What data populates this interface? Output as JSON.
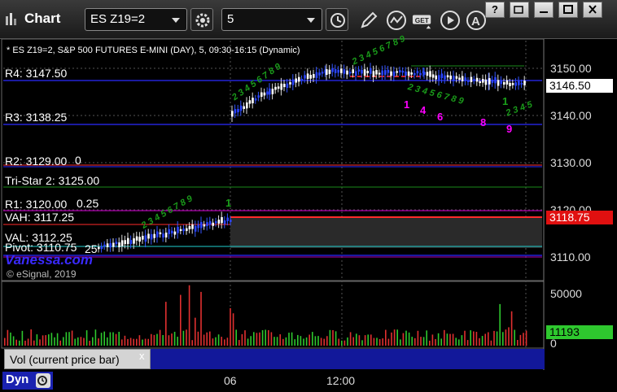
{
  "window": {
    "title": "Chart",
    "help_label": "?"
  },
  "toolbar": {
    "symbol_value": "ES Z19=2",
    "interval_value": "5",
    "icons": [
      "settings-icon",
      "clock-icon",
      "pencil-icon",
      "studies-icon",
      "get-icon",
      "play-icon",
      "link-icon"
    ]
  },
  "chart": {
    "header": "* ES Z19=2, S&P 500 FUTURES E-MINI (DAY), 5, 09:30-16:15 (Dynamic)",
    "watermark": "© eSignal, 2019",
    "brand": "Vanessa.com",
    "price_axis": {
      "ticks": [
        "3150.00",
        "3140.00",
        "3130.00",
        "3120.00",
        "3110.00"
      ],
      "current_price": "3146.50",
      "vah_price": "3118.75"
    },
    "levels": [
      {
        "label": "R4: 3147.50",
        "color": "#2a2aff"
      },
      {
        "label": "R3: 3138.25",
        "color": "#2a2aff"
      },
      {
        "label": "R2: 3129.00",
        "color": "#ff3030"
      },
      {
        "label": "Tri-Star 2: 3125.00",
        "color": "#1a8a1a"
      },
      {
        "label": "R1: 3120.00",
        "color": "#b000b0"
      },
      {
        "label": "VAH: 3117.25",
        "color": "#ff2a2a"
      },
      {
        "label": "VAL: 3112.25",
        "color": "#20d0d0"
      },
      {
        "label": "Pivot: 3110.75",
        "color": "#2a2aff"
      }
    ],
    "level_fragments": [
      "0",
      "0.25",
      "25"
    ],
    "sequential_labels": [
      {
        "text": "1",
        "color": "#ff00ff"
      },
      {
        "text": "4",
        "color": "#ff00ff"
      },
      {
        "text": "6",
        "color": "#ff00ff"
      },
      {
        "text": "8",
        "color": "#ff00ff"
      },
      {
        "text": "9",
        "color": "#ff00ff"
      },
      {
        "text": "1",
        "color": "#1aa01a"
      },
      {
        "text": "1",
        "color": "#1aa01a"
      }
    ],
    "setup_labels": [
      "2 3 4 5 6 7 8 9",
      "2 3 4 5 6 7 8 9",
      "2 3 4 5 6 7 8 9",
      "2 3 4 5 6 7 8 9",
      "2 3 4 5"
    ],
    "volume_axis": {
      "ticks": [
        "50000",
        "0"
      ],
      "current_volume": "11193"
    },
    "study_label": "Vol (current price bar)",
    "study_close": "x",
    "time_axis": [
      "06",
      "12:00"
    ],
    "dyn_label": "Dyn"
  },
  "chart_data": {
    "type": "candlestick",
    "ylim": [
      3105,
      3155
    ],
    "levels": [
      3147.5,
      3138.25,
      3129.0,
      3125.0,
      3120.0,
      3117.25,
      3112.25,
      3110.75
    ],
    "current_price": 3146.5,
    "volume_current": 11193,
    "volume_ylim": [
      0,
      60000
    ]
  }
}
